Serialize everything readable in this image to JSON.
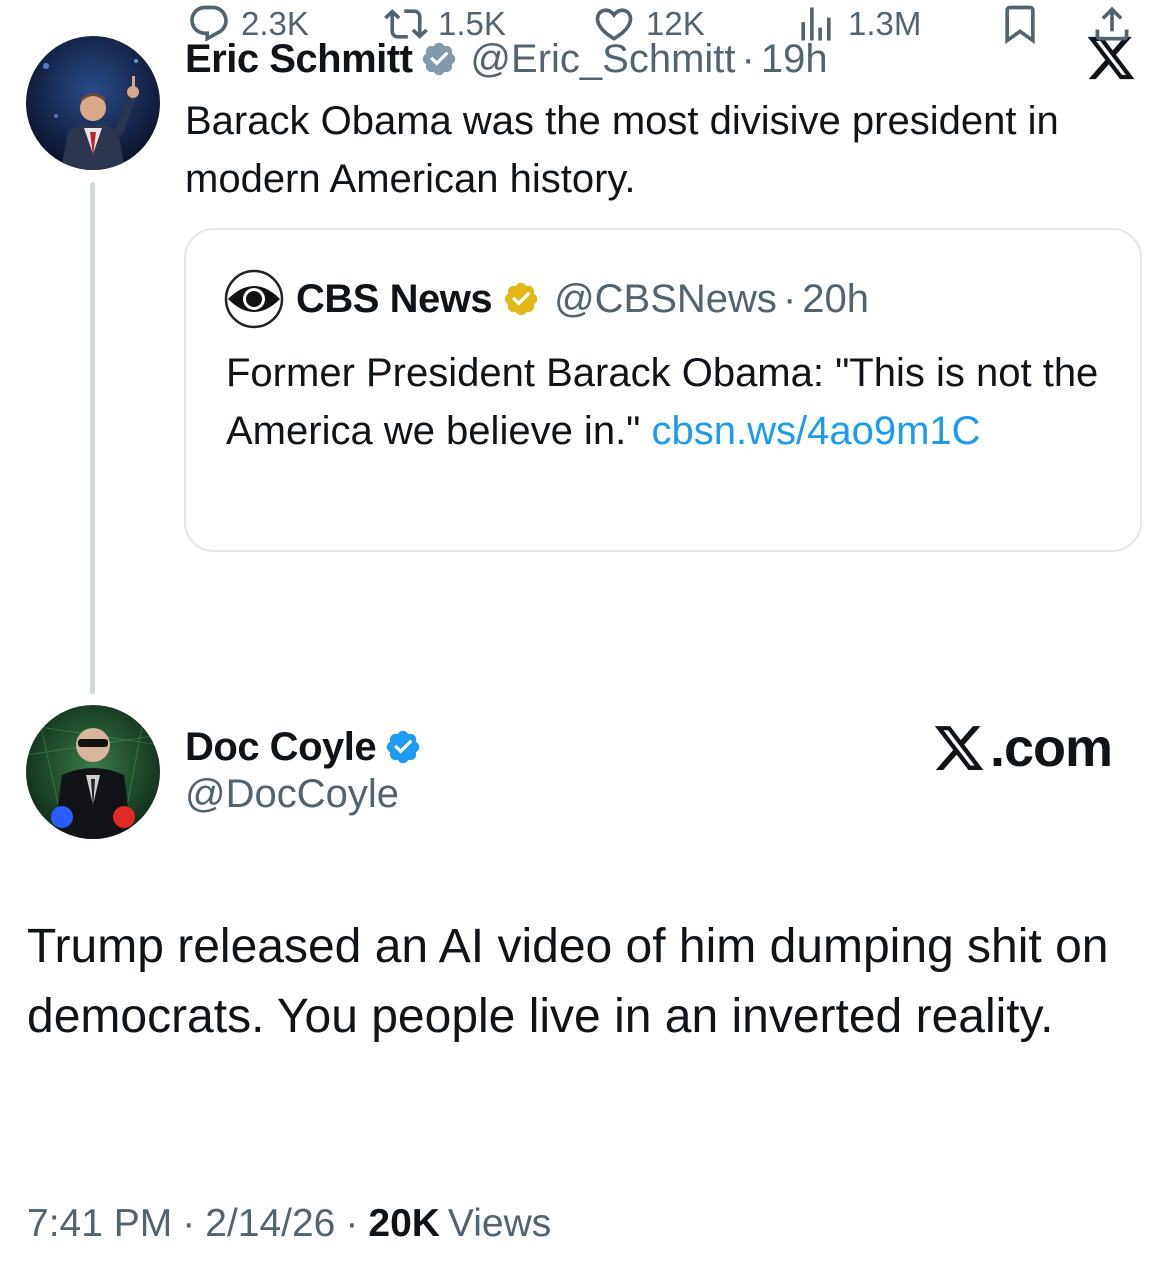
{
  "parent_tweet": {
    "author_name": "Eric Schmitt",
    "handle": "@Eric_Schmitt",
    "separator": "·",
    "time": "19h",
    "text": "Barack Obama was the most divisive president in modern American history.",
    "quote": {
      "author_name": "CBS News",
      "handle": "@CBSNews",
      "separator": "·",
      "time": "20h",
      "text": "Former President Barack Obama: \"This is not the America we believe in.\" ",
      "link": "cbsn.ws/4ao9m1C"
    },
    "actions": {
      "replies": "2.3K",
      "retweets": "1.5K",
      "likes": "12K",
      "views": "1.3M"
    }
  },
  "reply_tweet": {
    "author_name": "Doc Coyle",
    "handle": "@DocCoyle",
    "text": "Trump released an AI video of him dumping shit on democrats. You people live in an inverted reality.",
    "footer": {
      "time": "7:41 PM",
      "date": "2/14/26",
      "separator": "·",
      "views_count": "20K",
      "views_label": "Views"
    }
  },
  "watermark": ".com",
  "icons": {
    "verified_blue": "verified-badge-icon",
    "verified_gold": "gold-verified-badge-icon",
    "x_logo": "x-logo-icon",
    "cbs": "cbs-eye-logo",
    "reply": "reply-icon",
    "retweet": "retweet-icon",
    "like": "heart-icon",
    "views": "views-icon",
    "bookmark": "bookmark-icon",
    "share": "share-icon"
  },
  "colors": {
    "text": "#0f1419",
    "secondary": "#536471",
    "link": "#1d9bf0",
    "verified_blue": "#1d9bf0",
    "verified_gold": "#e2b719",
    "verified_gray": "#829aab",
    "border": "#e1e8ed"
  }
}
